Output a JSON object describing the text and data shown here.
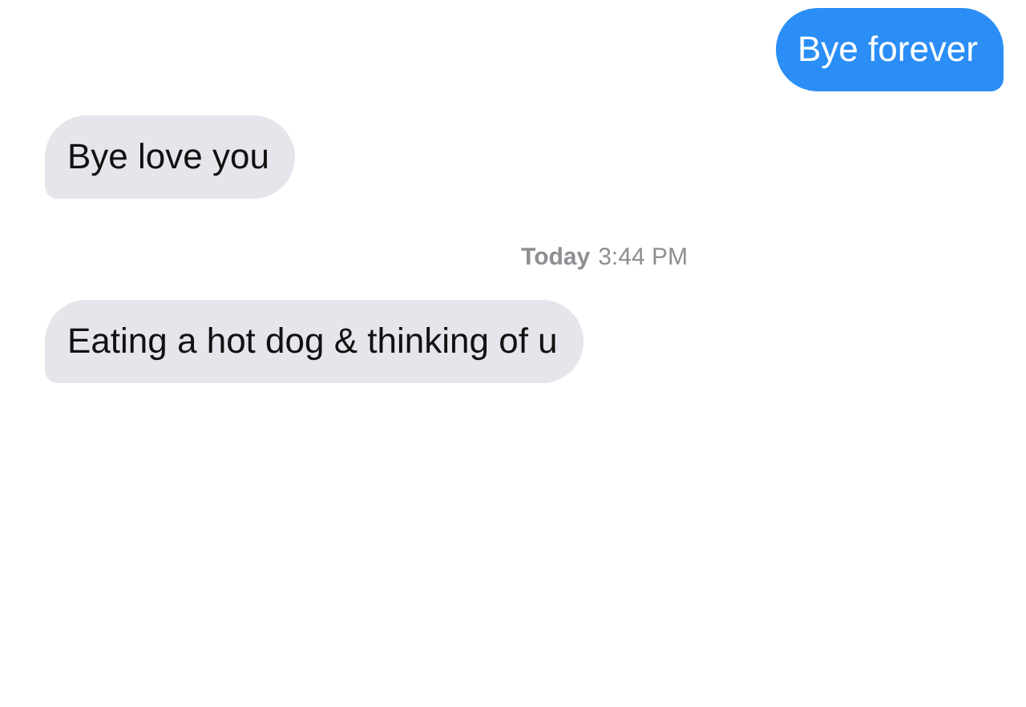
{
  "messages": [
    {
      "kind": "sent",
      "text": "Bye forever"
    },
    {
      "kind": "received",
      "text": "Bye love you"
    },
    {
      "kind": "timestamp",
      "day": "Today",
      "time": "3:44 PM"
    },
    {
      "kind": "received",
      "text": "Eating a hot dog & thinking of u"
    }
  ]
}
